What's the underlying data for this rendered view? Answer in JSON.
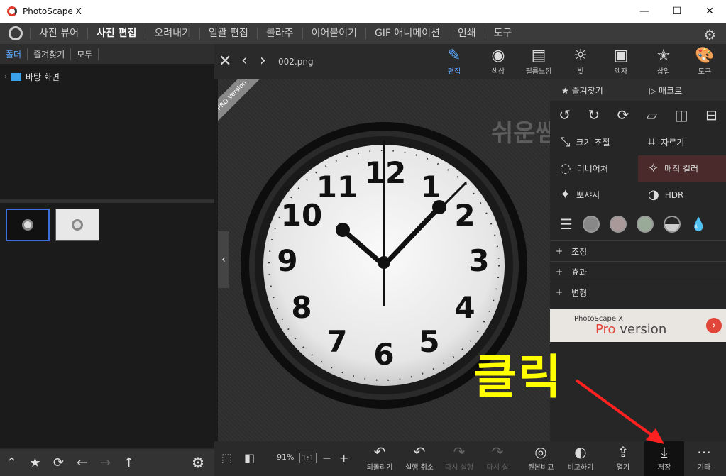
{
  "window": {
    "title": "PhotoScape X",
    "minimize": "—",
    "maximize": "☐",
    "close": "✕"
  },
  "menu": [
    "사진 뷰어",
    "사진 편집",
    "오려내기",
    "일괄 편집",
    "콜라주",
    "이어붙이기",
    "GIF 애니메이션",
    "인쇄",
    "도구"
  ],
  "left": {
    "tabs": [
      "폴더",
      "즐겨찾기",
      "모두"
    ],
    "tree_item": "바탕 화면"
  },
  "toolbar": {
    "filename": "002.png",
    "tools": [
      {
        "label": "편집",
        "icon": "✎"
      },
      {
        "label": "색상",
        "icon": "◉"
      },
      {
        "label": "필름느낌",
        "icon": "▤"
      },
      {
        "label": "빛",
        "icon": "☼"
      },
      {
        "label": "액자",
        "icon": "▣"
      },
      {
        "label": "삽입",
        "icon": "✭"
      },
      {
        "label": "도구",
        "icon": "🎨"
      }
    ]
  },
  "canvas": {
    "pro_badge": "PRO Version",
    "watermark": "쉬운쌤"
  },
  "right": {
    "favorites": "즐겨찾기",
    "macro": "매크로",
    "resize": "크기 조절",
    "crop": "자르기",
    "miniature": "미니어처",
    "magic_color": "매직 컬러",
    "bokeh": "뽀샤시",
    "hdr": "HDR",
    "sections": [
      "조정",
      "효과",
      "변형"
    ],
    "banner_small": "PhotoScape X",
    "banner_pro": "Pro",
    "banner_version": "version"
  },
  "bottom": {
    "zoom": "91%",
    "ratio": "1:1",
    "actions": [
      {
        "label": "되돌리기",
        "icon": "↶"
      },
      {
        "label": "실행 취소",
        "icon": "↶"
      },
      {
        "label": "다시 실행",
        "icon": "↷"
      },
      {
        "label": "다시 실",
        "icon": "↷"
      },
      {
        "label": "원본비교",
        "icon": "◎"
      },
      {
        "label": "비교하기",
        "icon": "◐"
      },
      {
        "label": "열기",
        "icon": "⇪"
      },
      {
        "label": "저장",
        "icon": "⤓"
      },
      {
        "label": "기타",
        "icon": "⋯"
      }
    ]
  },
  "annotation": {
    "text": "클릭",
    "color": "#ffff00",
    "arrow_color": "#ff2020"
  },
  "colors": {
    "accent": "#5aa9ff",
    "selection": "#3b6fe0"
  }
}
